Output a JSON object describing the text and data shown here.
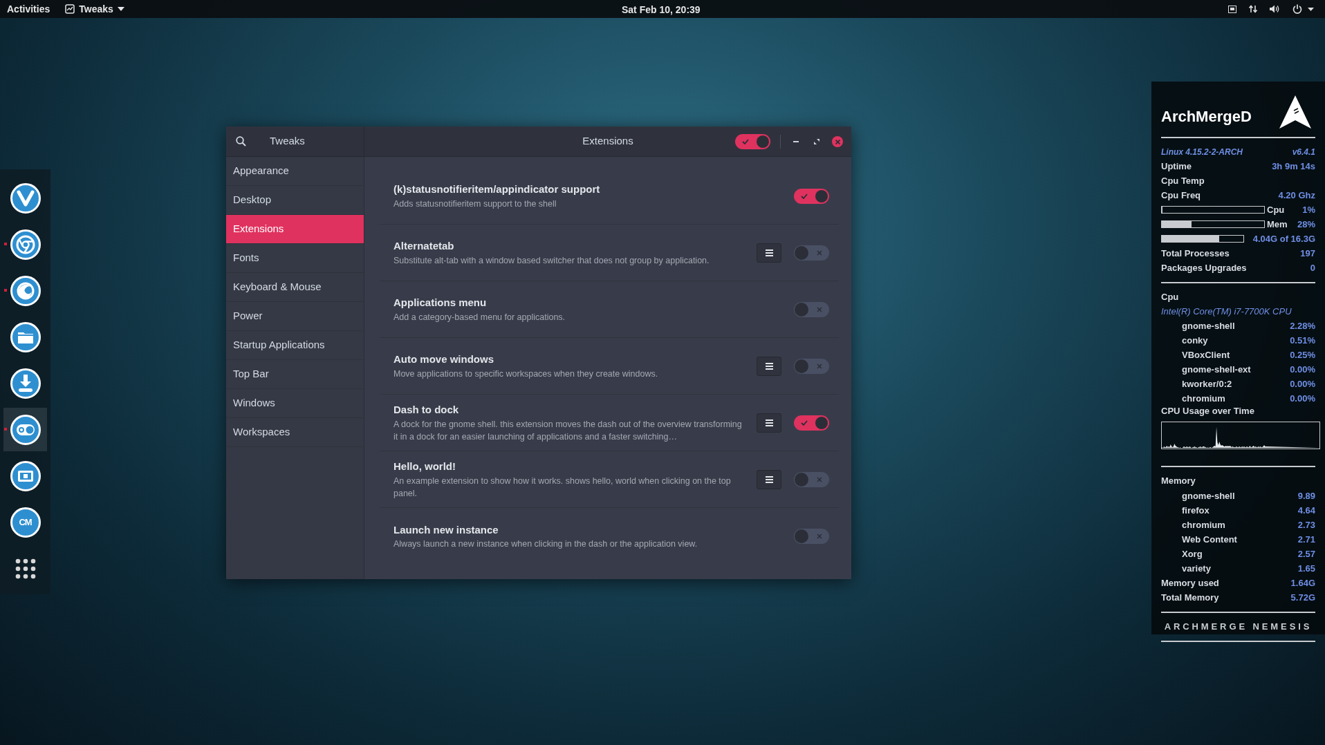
{
  "top_bar": {
    "activities": "Activities",
    "app_menu": {
      "label": "Tweaks"
    },
    "clock": "Sat Feb 10, 20:39"
  },
  "dock": [
    {
      "kind": "v-logo",
      "running": false,
      "focused": false
    },
    {
      "kind": "browser",
      "running": true,
      "focused": false
    },
    {
      "kind": "fox",
      "running": true,
      "focused": false
    },
    {
      "kind": "folder",
      "running": false,
      "focused": false
    },
    {
      "kind": "download",
      "running": false,
      "focused": false
    },
    {
      "kind": "toggle",
      "running": true,
      "focused": true
    },
    {
      "kind": "screen",
      "running": false,
      "focused": false
    },
    {
      "kind": "text",
      "label": "CM",
      "running": false,
      "focused": false
    },
    {
      "kind": "grid",
      "running": false,
      "focused": false
    }
  ],
  "window": {
    "sidebar_title": "Tweaks",
    "title": "Extensions",
    "master_switch": {
      "on": true
    }
  },
  "sidebar": {
    "items": [
      {
        "label": "Appearance",
        "selected": false
      },
      {
        "label": "Desktop",
        "selected": false
      },
      {
        "label": "Extensions",
        "selected": true
      },
      {
        "label": "Fonts",
        "selected": false
      },
      {
        "label": "Keyboard & Mouse",
        "selected": false
      },
      {
        "label": "Power",
        "selected": false
      },
      {
        "label": "Startup Applications",
        "selected": false
      },
      {
        "label": "Top Bar",
        "selected": false
      },
      {
        "label": "Windows",
        "selected": false
      },
      {
        "label": "Workspaces",
        "selected": false
      }
    ]
  },
  "extensions": [
    {
      "title": "(k)statusnotifieritem/appindicator support",
      "description": "Adds statusnotifieritem support to the shell",
      "has_settings": false,
      "on": true
    },
    {
      "title": "Alternatetab",
      "description": "Substitute alt-tab with a window based switcher that does not group by application.",
      "has_settings": true,
      "on": false
    },
    {
      "title": "Applications menu",
      "description": "Add a category-based menu for applications.",
      "has_settings": false,
      "on": false
    },
    {
      "title": "Auto move windows",
      "description": "Move applications to specific workspaces when they create windows.",
      "has_settings": true,
      "on": false
    },
    {
      "title": "Dash to dock",
      "description": "A dock for the gnome shell. this extension moves the dash out of the overview transforming it in a dock for an easier launching of applications and a faster switching…",
      "has_settings": true,
      "on": true
    },
    {
      "title": "Hello, world!",
      "description": "An example extension to show how it works. shows hello, world when clicking on the top panel.",
      "has_settings": true,
      "on": false
    },
    {
      "title": "Launch new instance",
      "description": "Always launch a new instance when clicking in the dash or the application view.",
      "has_settings": false,
      "on": false
    }
  ],
  "conky": {
    "hostname": "ArchMergeD",
    "kernel": "Linux 4.15.2-2-ARCH",
    "version": "v6.4.1",
    "stats": [
      {
        "label": "Uptime",
        "value": "3h 9m 14s"
      },
      {
        "label": "Cpu Temp"
      },
      {
        "label": "Cpu Freq",
        "value": "4.20 Ghz"
      }
    ],
    "bars": [
      {
        "kind": "labeled",
        "label": "Cpu",
        "value": "1%",
        "level": 0.01
      },
      {
        "kind": "labeled",
        "label": "Mem",
        "value": "28%",
        "level": 0.29
      },
      {
        "kind": "short",
        "value": "4.04G of 16.3G",
        "level": 0.7
      }
    ],
    "totals": [
      {
        "label": "Total Processes",
        "value": "197"
      },
      {
        "label": "Packages Upgrades",
        "value": "0"
      }
    ],
    "cpu": {
      "heading": "Cpu",
      "model": "Intel(R) Core(TM) i7-7700K CPU",
      "processes": [
        {
          "name": "gnome-shell",
          "value": "2.28%"
        },
        {
          "name": "conky",
          "value": "0.51%"
        },
        {
          "name": "VBoxClient",
          "value": "0.25%"
        },
        {
          "name": "gnome-shell-ext",
          "value": "0.00%"
        },
        {
          "name": "kworker/0:2",
          "value": "0.00%"
        },
        {
          "name": "chromium",
          "value": "0.00%"
        }
      ],
      "graph_title": "CPU Usage over Time"
    },
    "memory": {
      "heading": "Memory",
      "processes": [
        {
          "name": "gnome-shell",
          "value": "9.89"
        },
        {
          "name": "firefox",
          "value": "4.64"
        },
        {
          "name": "chromium",
          "value": "2.73"
        },
        {
          "name": "Web Content",
          "value": "2.71"
        },
        {
          "name": "Xorg",
          "value": "2.57"
        },
        {
          "name": "variety",
          "value": "1.65"
        }
      ],
      "summary": [
        {
          "label": "Memory used",
          "value": "1.64G"
        },
        {
          "label": "Total Memory",
          "value": "5.72G"
        }
      ]
    },
    "footer": "ARCHMERGE NEMESIS"
  }
}
